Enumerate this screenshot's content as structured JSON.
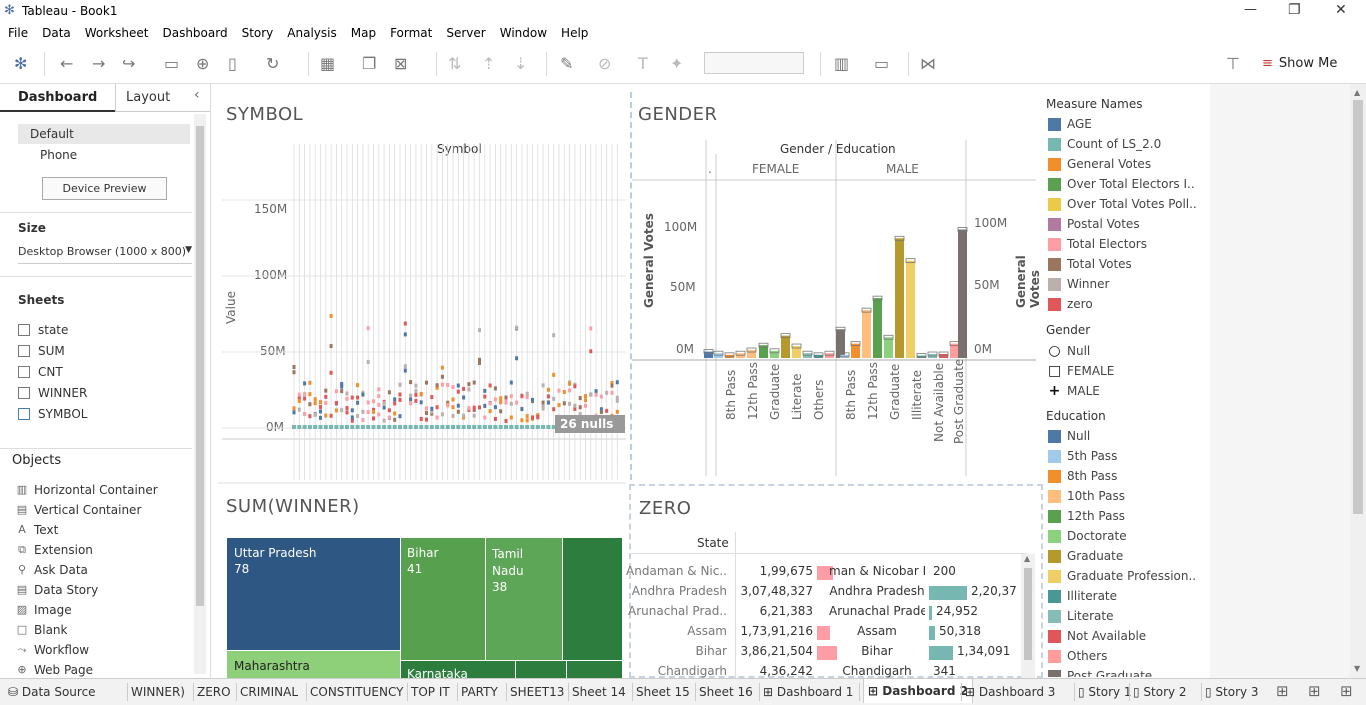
{
  "window": {
    "title": "Tableau - Book1",
    "min": "—",
    "max": "❐",
    "close": "✕"
  },
  "menu": [
    "File",
    "Data",
    "Worksheet",
    "Dashboard",
    "Story",
    "Analysis",
    "Map",
    "Format",
    "Server",
    "Window",
    "Help"
  ],
  "toolbar": {
    "show_me": "Show Me"
  },
  "sidebar": {
    "tab_dashboard": "Dashboard",
    "tab_layout": "Layout",
    "device_default": "Default",
    "device_phone": "Phone",
    "device_preview": "Device Preview",
    "size_title": "Size",
    "size_value": "Desktop Browser (1000 x 800)",
    "sheets_title": "Sheets",
    "sheets": [
      "state",
      "SUM",
      "CNT",
      "WINNER",
      "SYMBOL"
    ],
    "objects_title": "Objects",
    "objects": [
      "Horizontal Container",
      "Vertical Container",
      "Text",
      "Extension",
      "Ask Data",
      "Data Story",
      "Image",
      "Blank",
      "Workflow",
      "Web Page"
    ]
  },
  "symbol": {
    "title": "SYMBOL",
    "header": "Symbol",
    "ylabel": "Value",
    "ticks": [
      "150M",
      "100M",
      "50M",
      "0M"
    ],
    "nulls": "26 nulls"
  },
  "gender": {
    "title": "GENDER",
    "header": "Gender / Education",
    "col_dot": ".",
    "col_female": "FEMALE",
    "col_male": "MALE",
    "ylabel_left": "General Votes",
    "ylabel_right": "General Votes",
    "ticks_left": [
      "100M",
      "50M",
      "0M"
    ],
    "ticks_right": [
      "100M",
      "50M",
      "0M"
    ],
    "female_x": [
      "8th Pass",
      "12th Pass",
      "Graduate",
      "Literate",
      "Others"
    ],
    "male_x": [
      "8th Pass",
      "12th Pass",
      "Graduate",
      "Illiterate",
      "Not Available",
      "Post Graduate"
    ]
  },
  "winner": {
    "title": "SUM(WINNER)",
    "cells": [
      {
        "name": "Uttar Pradesh",
        "value": "78"
      },
      {
        "name": "Bihar",
        "value": "41"
      },
      {
        "name": "Tamil Nadu",
        "value": "38"
      },
      {
        "name": "Maharashtra",
        "value": ""
      },
      {
        "name": "Karnataka",
        "value": ""
      }
    ]
  },
  "zero": {
    "title": "ZERO",
    "col_state": "State",
    "rows": [
      {
        "state": "Andaman & Nic..",
        "v1": "1,99,675",
        "s2": "man & Nicobar Isl",
        "v2": "200"
      },
      {
        "state": "Andhra Pradesh",
        "v1": "3,07,48,327",
        "s2": "Andhra Pradesh",
        "v2": "2,20,37"
      },
      {
        "state": "Arunachal Prad..",
        "v1": "6,21,383",
        "s2": "Arunachal Pradesh",
        "v2": "24,952"
      },
      {
        "state": "Assam",
        "v1": "1,73,91,216",
        "s2": "Assam",
        "v2": "50,318"
      },
      {
        "state": "Bihar",
        "v1": "3,86,21,504",
        "s2": "Bihar",
        "v2": "1,34,091"
      },
      {
        "state": "Chandigarh",
        "v1": "4,36,242",
        "s2": "Chandigarh",
        "v2": "341"
      }
    ]
  },
  "legend": {
    "measure_title": "Measure Names",
    "measures": [
      {
        "label": "AGE",
        "color": "#4e79a7"
      },
      {
        "label": "Count of LS_2.0",
        "color": "#76b7b2"
      },
      {
        "label": "General Votes",
        "color": "#f28e2b"
      },
      {
        "label": "Over Total Electors  I..",
        "color": "#59a14f"
      },
      {
        "label": "Over Total Votes Poll..",
        "color": "#edc948"
      },
      {
        "label": "Postal Votes",
        "color": "#b07aa1"
      },
      {
        "label": "Total Electors",
        "color": "#ff9da7"
      },
      {
        "label": "Total Votes",
        "color": "#9c755f"
      },
      {
        "label": "Winner",
        "color": "#bab0ac"
      },
      {
        "label": "zero",
        "color": "#e15759"
      }
    ],
    "gender_title": "Gender",
    "genders": [
      {
        "label": "Null",
        "shape": "circle"
      },
      {
        "label": "FEMALE",
        "shape": "square"
      },
      {
        "label": "MALE",
        "shape": "plus"
      }
    ],
    "education_title": "Education",
    "education": [
      {
        "label": "Null",
        "color": "#4e79a7"
      },
      {
        "label": "5th Pass",
        "color": "#a0cbe8"
      },
      {
        "label": "8th Pass",
        "color": "#f28e2b"
      },
      {
        "label": "10th Pass",
        "color": "#ffbe7d"
      },
      {
        "label": "12th Pass",
        "color": "#59a14f"
      },
      {
        "label": "Doctorate",
        "color": "#8cd17d"
      },
      {
        "label": "Graduate",
        "color": "#b6992d"
      },
      {
        "label": "Graduate Profession..",
        "color": "#f1ce63"
      },
      {
        "label": "Illiterate",
        "color": "#499894"
      },
      {
        "label": "Literate",
        "color": "#86bcb6"
      },
      {
        "label": "Not Available",
        "color": "#e15759"
      },
      {
        "label": "Others",
        "color": "#ff9d9a"
      },
      {
        "label": "Post Graduate",
        "color": "#79706e"
      }
    ]
  },
  "tabs": [
    "Data Source",
    "WINNER)",
    "ZERO",
    "CRIMINAL",
    "CONSTITUENCY",
    "TOP IT",
    "PARTY",
    "SHEET13",
    "Sheet 14",
    "Sheet 15",
    "Sheet 16",
    "Dashboard 1",
    "Dashboard 2",
    "Dashboard 3",
    "Story 1",
    "Story 2",
    "Story 3"
  ]
}
